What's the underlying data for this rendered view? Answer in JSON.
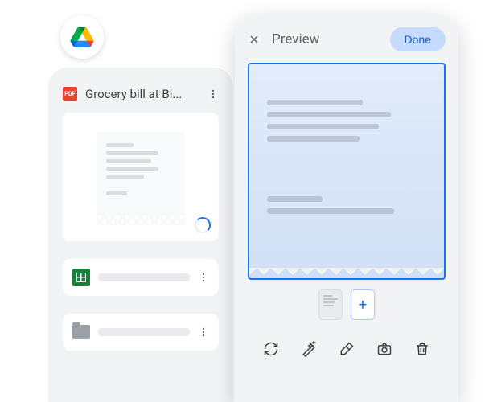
{
  "file": {
    "title": "Grocery bill at Bi...",
    "badge": "PDF"
  },
  "preview": {
    "title": "Preview",
    "done_label": "Done",
    "add_label": "+"
  }
}
